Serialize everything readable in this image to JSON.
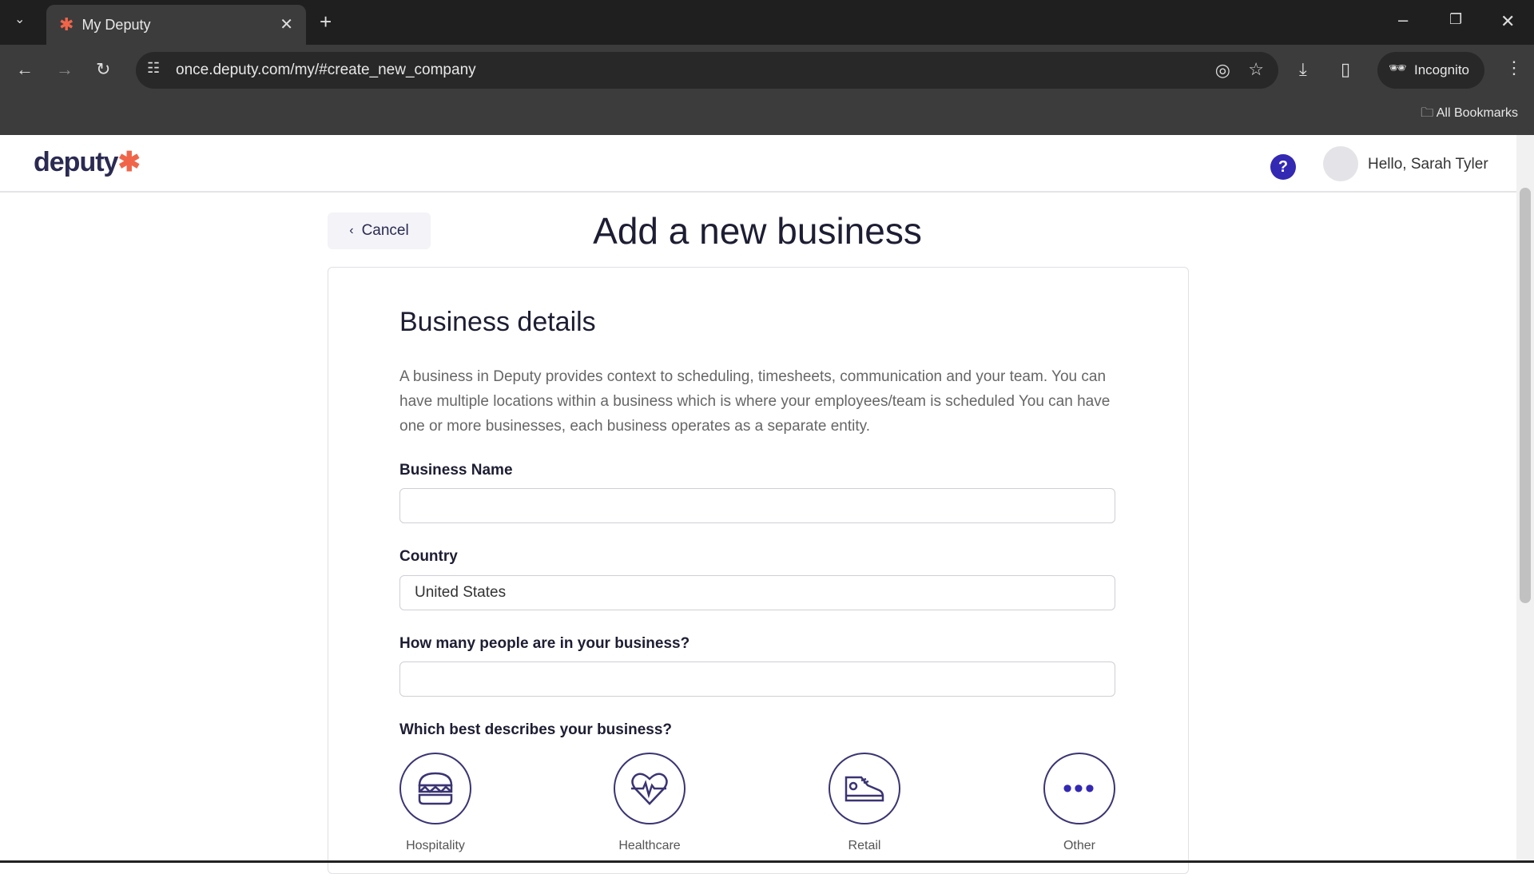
{
  "browser": {
    "tab_title": "My Deputy",
    "url": "once.deputy.com/my/#create_new_company",
    "incognito": "Incognito",
    "bookmarks": "All Bookmarks"
  },
  "header": {
    "logo": "deputy",
    "greeting": "Hello, Sarah Tyler",
    "help": "?"
  },
  "page": {
    "cancel": "Cancel",
    "title": "Add a new business"
  },
  "form": {
    "section_title": "Business details",
    "description": "A business in Deputy provides context to scheduling, timesheets, communication and your team. You can have multiple locations within a business which is where your employees/team is scheduled You can have one or more businesses, each business operates as a separate entity.",
    "business_name_label": "Business Name",
    "business_name_value": "",
    "country_label": "Country",
    "country_value": "United States",
    "people_label": "How many people are in your business?",
    "people_value": "",
    "type_label": "Which best describes your business?",
    "types": [
      {
        "label": "Hospitality",
        "icon": "burger-icon"
      },
      {
        "label": "Healthcare",
        "icon": "heartbeat-icon"
      },
      {
        "label": "Retail",
        "icon": "sneaker-icon"
      },
      {
        "label": "Other",
        "icon": "more-icon"
      }
    ]
  }
}
